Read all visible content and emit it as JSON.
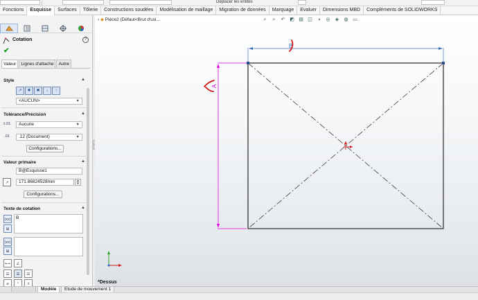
{
  "toolbar": {
    "move_entities_label": "Déplacer les entités"
  },
  "command_tabs": [
    {
      "label": "Fonctions",
      "active": false
    },
    {
      "label": "Esquisse",
      "active": true
    },
    {
      "label": "Surfaces",
      "active": false
    },
    {
      "label": "Tôlerie",
      "active": false
    },
    {
      "label": "Constructions soudées",
      "active": false
    },
    {
      "label": "Modélisation de maillage",
      "active": false
    },
    {
      "label": "Migration de données",
      "active": false
    },
    {
      "label": "Marquage",
      "active": false
    },
    {
      "label": "Evaluer",
      "active": false
    },
    {
      "label": "Dimensions MBD",
      "active": false
    },
    {
      "label": "Compléments de SOLIDWORKS",
      "active": false
    }
  ],
  "property_manager": {
    "title": "Cotation",
    "help": "?",
    "tabs": [
      {
        "label": "Valeur",
        "active": true
      },
      {
        "label": "Lignes d'attache",
        "active": false
      },
      {
        "label": "Autre",
        "active": false
      }
    ],
    "style": {
      "heading": "Style",
      "dropdown_value": "<AUCUN>"
    },
    "tolerance": {
      "heading": "Tolérance/Précision",
      "tolerance_value": "Aucune",
      "precision_value": ".12 (Document)",
      "configurations_label": "Configurations..."
    },
    "primary_value": {
      "heading": "Valeur primaire",
      "name": "B@Esquisse1",
      "value": "171.86824528mm",
      "configurations_label": "Configurations..."
    },
    "dimension_text": {
      "heading": "Texte de cotation",
      "text": "B"
    }
  },
  "graphics": {
    "tree_item": "Pièce2  (Défaut<Brut d'usi...",
    "dimension_top_label": "B",
    "dimension_side_label": "A",
    "view_label": "*Dessus"
  },
  "bottom_tabs": [
    {
      "label": "Modèle",
      "active": true
    },
    {
      "label": "Etude de mouvement 1",
      "active": false
    }
  ],
  "colors": {
    "dimension_blue": "#3b6fb8",
    "dimension_magenta": "#e000e0",
    "annotation_red": "#d01818",
    "sketch_black": "#111111"
  }
}
